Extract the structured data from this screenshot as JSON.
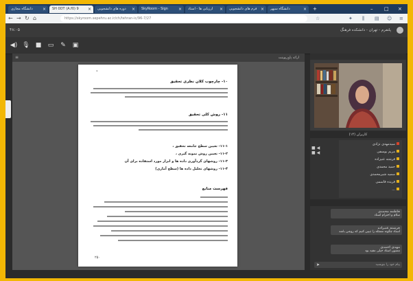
{
  "browser": {
    "tabs": [
      {
        "label": "دانشگاه سپهر"
      },
      {
        "label": "فرم های دانشجویی"
      },
      {
        "label": "ارزیابی ها - استاد"
      },
      {
        "label": "SkyRoom - Sign"
      },
      {
        "label": "دوره های دانشجویی"
      },
      {
        "label": "SH 0DT (A.f0) 9"
      },
      {
        "label": "دانشگاه مجازی"
      }
    ],
    "url": "https://skyroom.sepehru.ac.ir/ch/tehran-ic/96-7/27"
  },
  "app": {
    "title": "پلتفرم - تهران - دانشکده فرهنگ",
    "clock": "۴۸:۰۵",
    "doc_panel_label": "ارائه پاورپوینت",
    "users_panel_label": "کاربران (۱۴)",
    "chat_input_placeholder": "پیام خود را بنویسید",
    "page_number": "۲۵۰",
    "page_mark": "*"
  },
  "document": {
    "h1": "۱۰- چارچوب کلان نظری تحقیق",
    "h2": "۱۱- روش کلی تحقیق",
    "bullets": [
      "۱۱-۱- تعیین سطح جامعه تحقیق ،",
      "۱۱-۲- تعیین روش نمونه گیری ،",
      "۱۱-۳- روشهای گردآوری داده ها و ابزار مورد استفاده برای آن",
      "۱۱-۴- روشهای تحلیل داده ها (سطح آماری)"
    ],
    "h3": "فهرست منابع"
  },
  "users": [
    {
      "name": "سیدمهدی نژادی",
      "color": "#d9442b"
    },
    {
      "name": "مریم یوسفی",
      "color": "#e6b01a"
    },
    {
      "name": "فرشته غنیزاده",
      "color": "#e6b01a"
    },
    {
      "name": "حمید محمدی",
      "color": "#e6b01a"
    },
    {
      "name": "سمیه شیرمحمدی",
      "color": "#e6b01a"
    },
    {
      "name": "فریده قاسمی",
      "color": "#e6b01a"
    },
    {
      "name": "...",
      "color": "#e6b01a"
    }
  ],
  "chat": [
    {
      "name": "فاطمه محمدی",
      "text": "سلام و احترام استاد"
    },
    {
      "name": "فرشته غنیزاده",
      "text": "استاد چگونه مسئله را تبیین کنیم که روشن باشد"
    },
    {
      "name": "مهدی احمدی",
      "text": "ممنون استاد خیلی مفید بود"
    }
  ]
}
